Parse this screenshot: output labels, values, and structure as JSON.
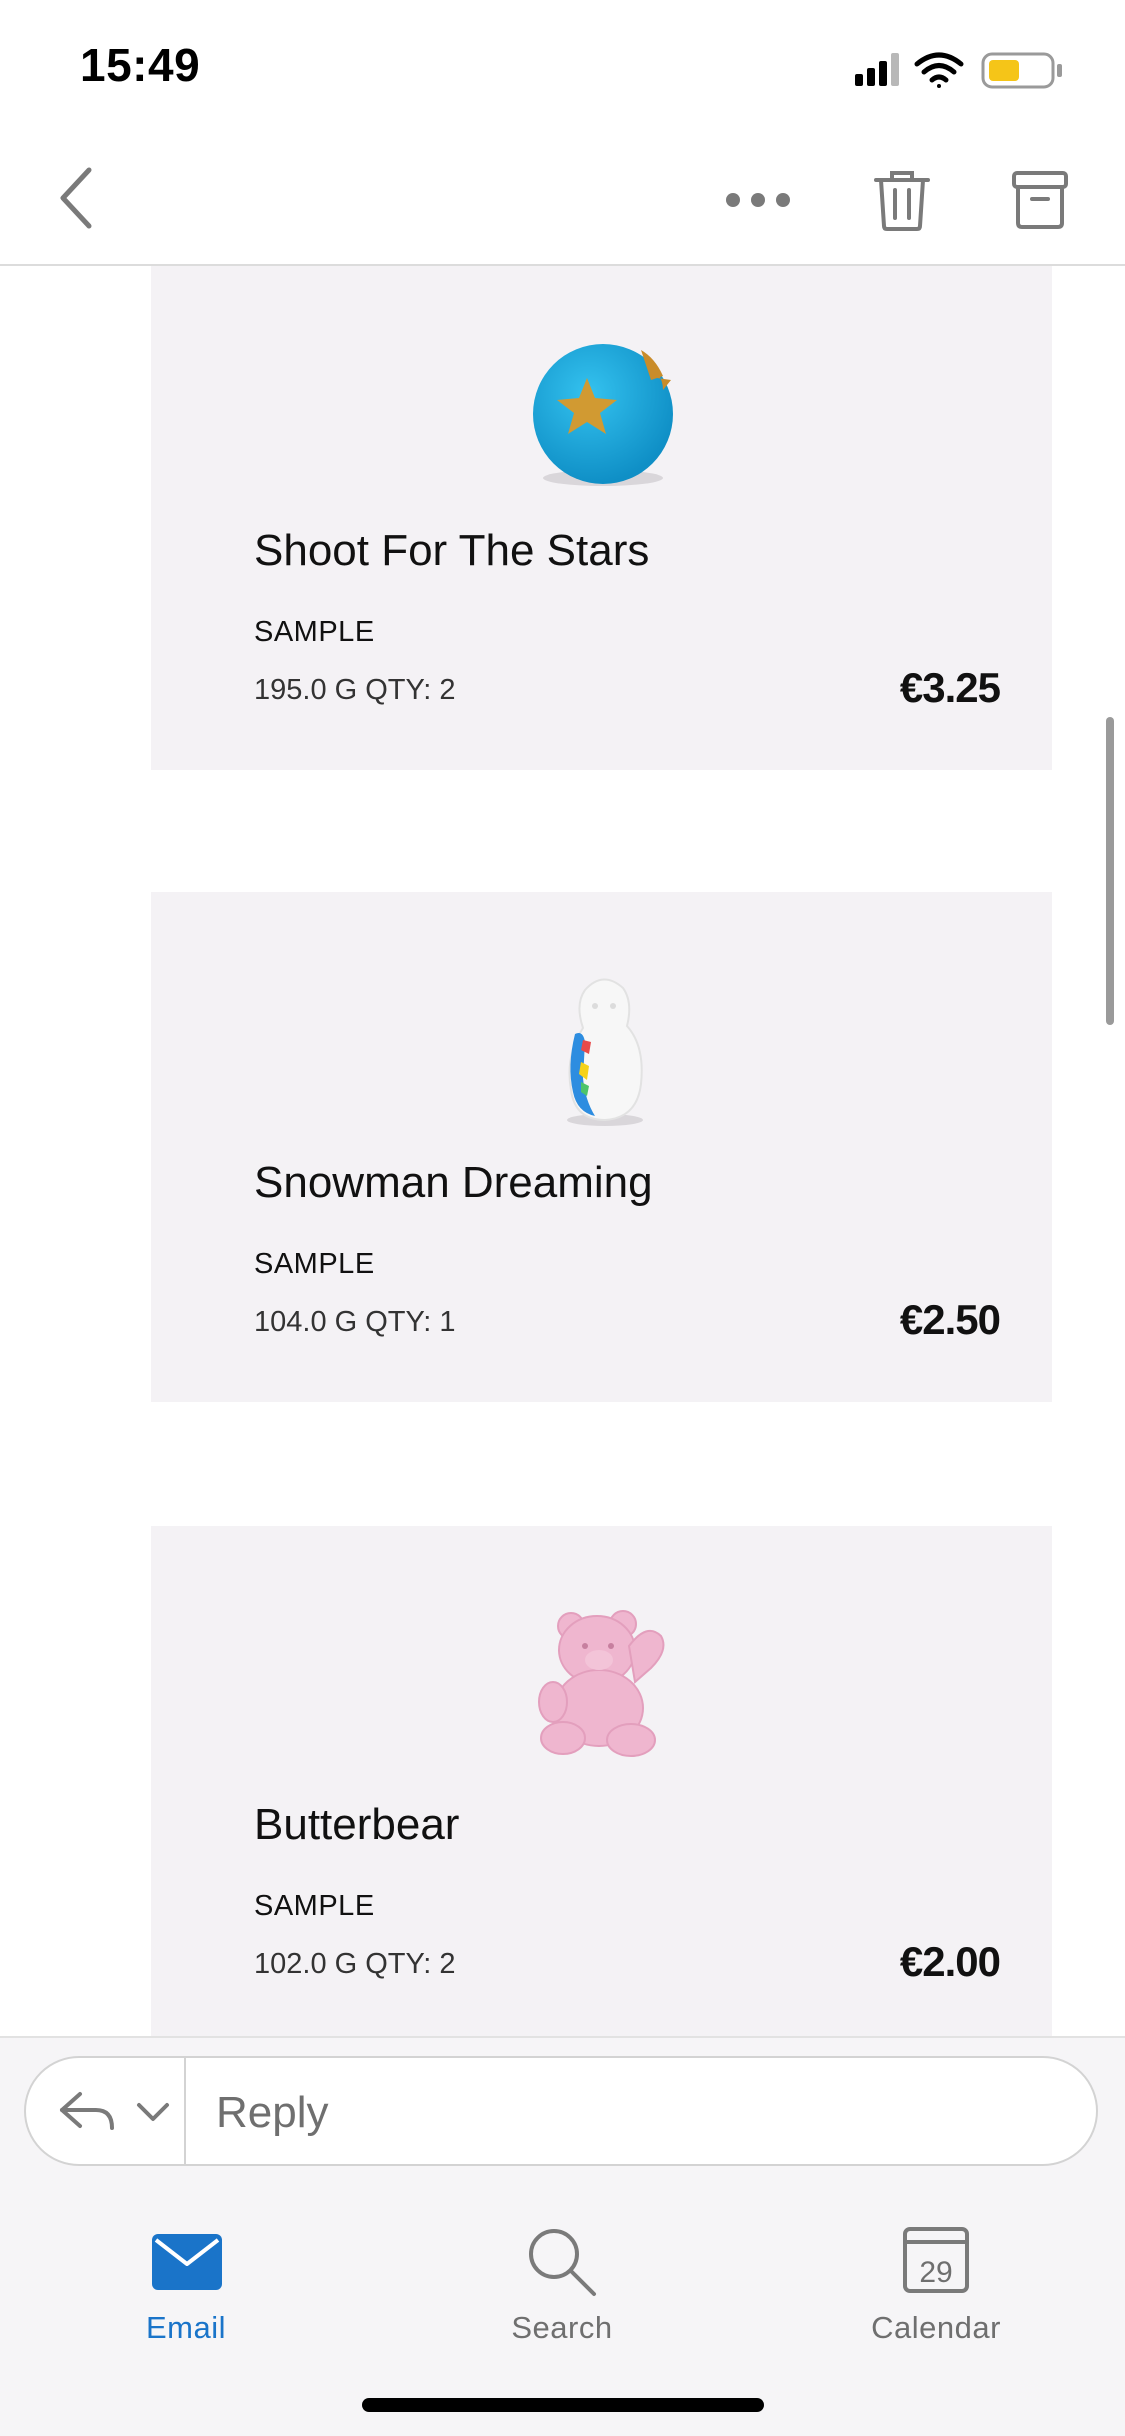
{
  "status_bar": {
    "time": "15:49",
    "icons": [
      "cellular-signal-icon",
      "wifi-icon",
      "battery-icon"
    ],
    "battery_color": "#f5c518"
  },
  "nav": {
    "icons": [
      "back-chevron-icon",
      "more-icon",
      "trash-icon",
      "archive-icon"
    ]
  },
  "products": [
    {
      "name": "Shoot For The Stars",
      "label": "SAMPLE",
      "meta": "195.0 G QTY: 2",
      "price": "€3.25",
      "image": "blue-bath-bomb-with-gold-stars"
    },
    {
      "name": "Snowman Dreaming",
      "label": "SAMPLE",
      "meta": "104.0 G QTY: 1",
      "price": "€2.50",
      "image": "white-snowman-bath-bomb"
    },
    {
      "name": "Butterbear",
      "label": "SAMPLE",
      "meta": "102.0 G QTY: 2",
      "price": "€2.00",
      "image": "pink-bear-bath-bomb"
    }
  ],
  "reply": {
    "placeholder": "Reply",
    "icons": [
      "reply-arrow-icon",
      "chevron-down-icon"
    ]
  },
  "tabs": [
    {
      "label": "Email",
      "icon": "envelope-icon",
      "active": true
    },
    {
      "label": "Search",
      "icon": "magnifier-icon",
      "active": false
    },
    {
      "label": "Calendar",
      "icon": "calendar-icon",
      "active": false,
      "day": "29"
    }
  ],
  "colors": {
    "accent": "#1a74c9",
    "card_bg": "#f4f2f5",
    "inactive": "#6f6f6f"
  }
}
